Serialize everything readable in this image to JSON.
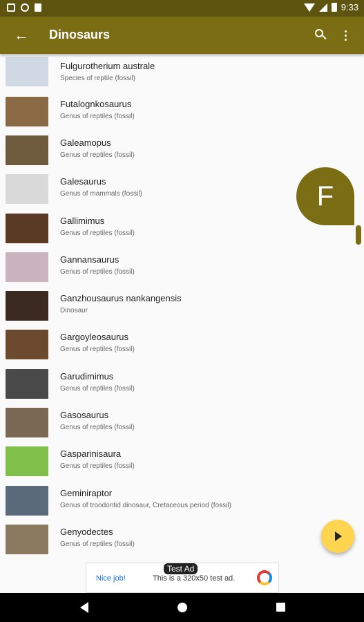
{
  "status_bar": {
    "time": "9:33"
  },
  "app_bar": {
    "title": "Dinosaurs"
  },
  "items": [
    {
      "title": "Fulgurotherium australe",
      "subtitle": "Species of reptile (fossil)",
      "color": "#cfd8e3"
    },
    {
      "title": "Futalognkosaurus",
      "subtitle": "Genus of reptiles (fossil)",
      "color": "#8a6a44"
    },
    {
      "title": "Galeamopus",
      "subtitle": "Genus of reptiles (fossil)",
      "color": "#6e5a3c"
    },
    {
      "title": "Galesaurus",
      "subtitle": "Genus of mammals (fossil)",
      "color": "#d9d9d9"
    },
    {
      "title": "Gallimimus",
      "subtitle": "Genus of reptiles (fossil)",
      "color": "#5a3a22"
    },
    {
      "title": "Gannansaurus",
      "subtitle": "Genus of reptiles (fossil)",
      "color": "#c9b3bd"
    },
    {
      "title": "Ganzhousaurus nankangensis",
      "subtitle": "Dinosaur",
      "color": "#3b2a22"
    },
    {
      "title": "Gargoyleosaurus",
      "subtitle": "Genus of reptiles (fossil)",
      "color": "#6b4a2e"
    },
    {
      "title": "Garudimimus",
      "subtitle": "Genus of reptiles (fossil)",
      "color": "#4a4a4a"
    },
    {
      "title": "Gasosaurus",
      "subtitle": "Genus of reptiles (fossil)",
      "color": "#7a6a55"
    },
    {
      "title": "Gasparinisaura",
      "subtitle": "Genus of reptiles (fossil)",
      "color": "#7fbf4a"
    },
    {
      "title": "Geminiraptor",
      "subtitle": "Genus of troodontid dinosaur, Cretaceous period (fossil)",
      "color": "#5a6a7a"
    },
    {
      "title": "Genyodectes",
      "subtitle": "Genus of reptiles (fossil)",
      "color": "#8a7a60"
    }
  ],
  "fast_scroll_letter": "F",
  "ad": {
    "label": "Test Ad",
    "nice": "Nice job!",
    "text": "This is a 320x50 test ad."
  },
  "colors": {
    "primary": "#7b6d14",
    "primary_dark": "#5e5410",
    "fab": "#ffd54f"
  }
}
